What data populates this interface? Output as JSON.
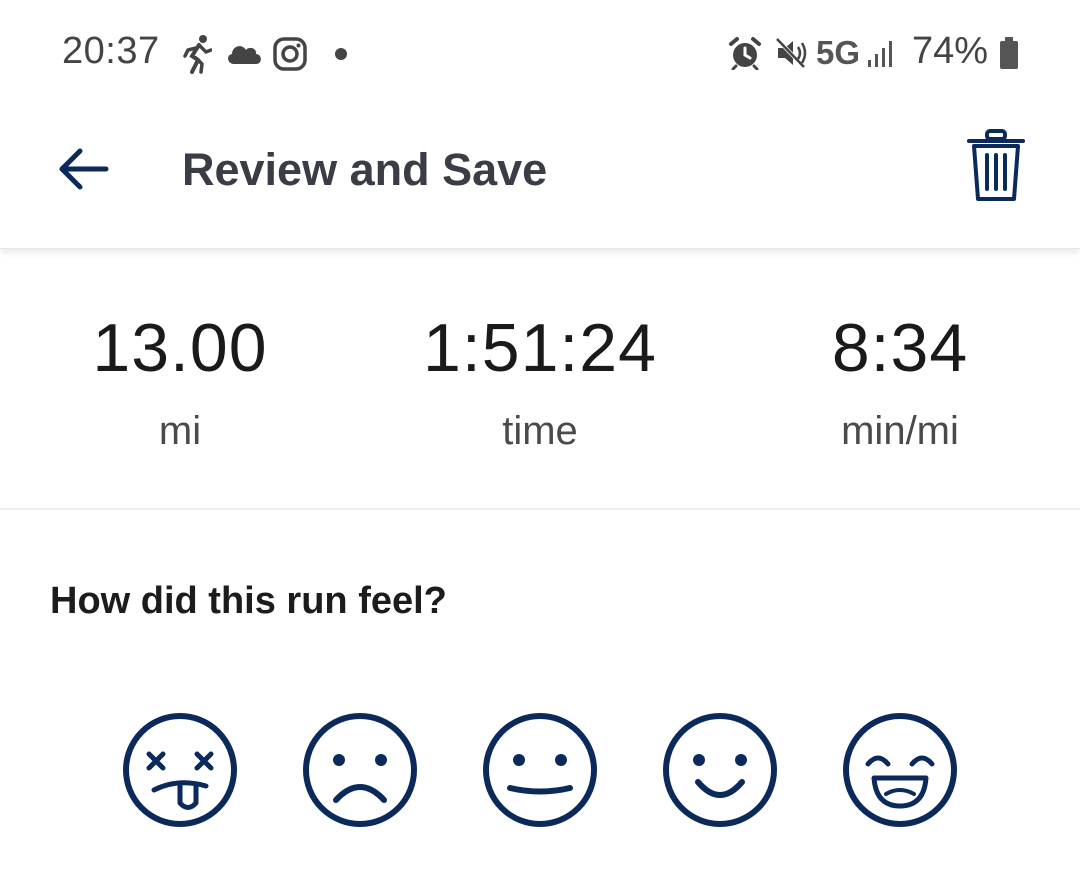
{
  "status_bar": {
    "time": "20:37",
    "network": "5G",
    "battery": "74%",
    "icons": [
      "running-icon",
      "cloud-icon",
      "instagram-icon",
      "dot-icon",
      "alarm-icon",
      "mute-icon",
      "signal-icon",
      "battery-icon"
    ]
  },
  "header": {
    "title": "Review and Save",
    "back_icon": "arrow-left-icon",
    "delete_icon": "trash-icon"
  },
  "stats": [
    {
      "value": "13.00",
      "unit": "mi"
    },
    {
      "value": "1:51:24",
      "unit": "time"
    },
    {
      "value": "8:34",
      "unit": "min/mi"
    }
  ],
  "feel": {
    "question": "How did this run feel?",
    "options": [
      "exhausted-face-icon",
      "sad-face-icon",
      "neutral-face-icon",
      "smile-face-icon",
      "grin-face-icon"
    ]
  },
  "colors": {
    "accent": "#0b2a5b",
    "text": "#1a1a1a",
    "status_text": "#444444"
  }
}
